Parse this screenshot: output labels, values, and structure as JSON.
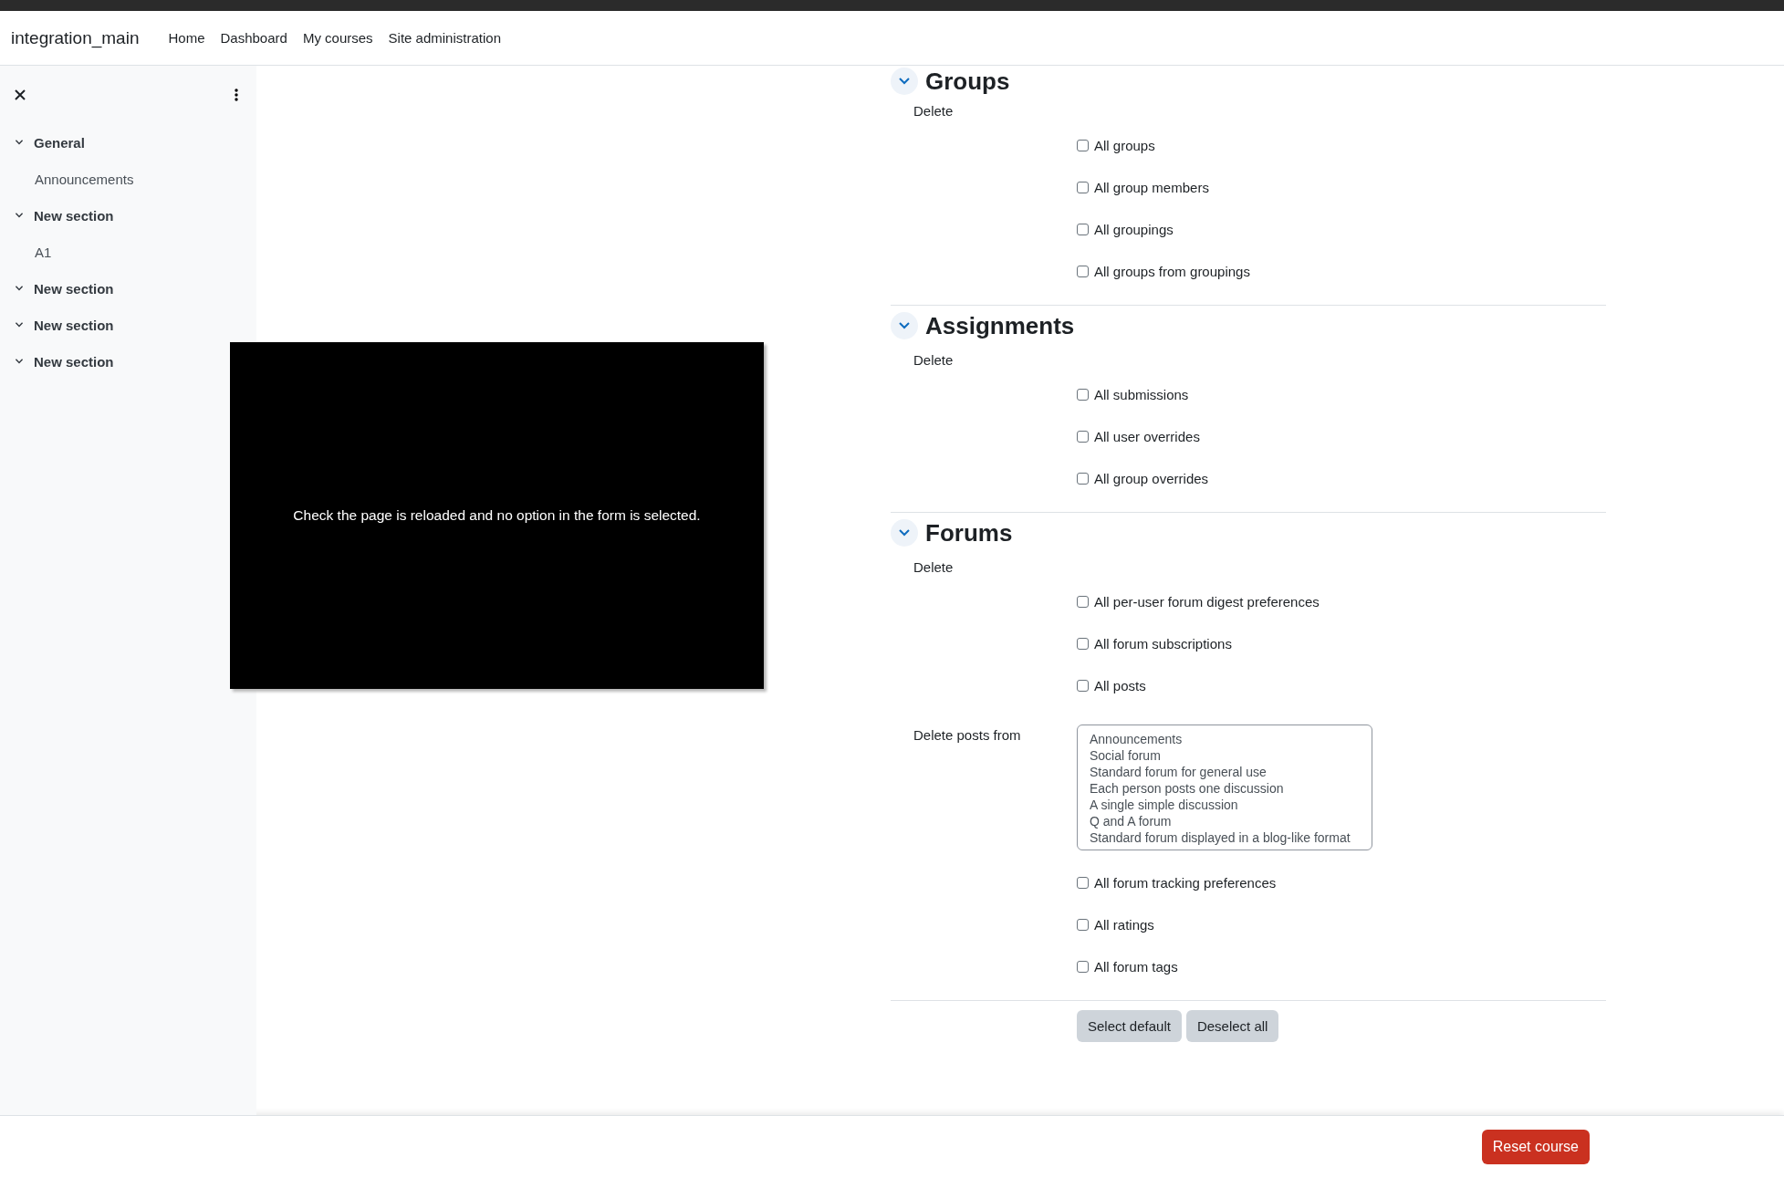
{
  "navbar": {
    "brand": "integration_main",
    "links": [
      "Home",
      "Dashboard",
      "My courses",
      "Site administration"
    ]
  },
  "drawer": {
    "sections": [
      {
        "label": "General",
        "expanded": true,
        "children": [
          {
            "label": "Announcements"
          }
        ]
      },
      {
        "label": "New section",
        "expanded": true,
        "children": [
          {
            "label": "A1"
          }
        ]
      },
      {
        "label": "New section",
        "expanded": true
      },
      {
        "label": "New section",
        "expanded": true
      },
      {
        "label": "New section",
        "expanded": true
      }
    ]
  },
  "sections": [
    {
      "title": "Groups",
      "expanded": true,
      "delete_label": "Delete",
      "fields": [
        {
          "kind": "checkbox",
          "label": "All groups",
          "checked": false
        },
        {
          "kind": "checkbox",
          "label": "All group members",
          "checked": false
        },
        {
          "kind": "checkbox",
          "label": "All groupings",
          "checked": false
        },
        {
          "kind": "checkbox",
          "label": "All groups from groupings",
          "checked": false
        }
      ]
    },
    {
      "title": "Assignments",
      "expanded": true,
      "delete_label": "Delete",
      "fields": [
        {
          "kind": "checkbox",
          "label": "All submissions",
          "checked": false
        },
        {
          "kind": "checkbox",
          "label": "All user overrides",
          "checked": false
        },
        {
          "kind": "checkbox",
          "label": "All group overrides",
          "checked": false
        }
      ]
    },
    {
      "title": "Forums",
      "expanded": true,
      "delete_label": "Delete",
      "fields": [
        {
          "kind": "checkbox",
          "label": "All per-user forum digest preferences",
          "checked": false
        },
        {
          "kind": "checkbox",
          "label": "All forum subscriptions",
          "checked": false
        },
        {
          "kind": "checkbox",
          "label": "All posts",
          "checked": false
        },
        {
          "kind": "listbox",
          "label": "Delete posts from",
          "options": [
            {
              "label": "Announcements",
              "selected": false
            },
            {
              "label": "Social forum",
              "selected": false
            },
            {
              "label": "Standard forum for general use",
              "selected": false
            },
            {
              "label": "Each person posts one discussion",
              "selected": false
            },
            {
              "label": "A single simple discussion",
              "selected": false
            },
            {
              "label": "Q and A forum",
              "selected": false
            },
            {
              "label": "Standard forum displayed in a blog-like format",
              "selected": false
            }
          ]
        },
        {
          "kind": "checkbox",
          "label": "All forum tracking preferences",
          "checked": false
        },
        {
          "kind": "checkbox",
          "label": "All ratings",
          "checked": false
        },
        {
          "kind": "checkbox",
          "label": "All forum tags",
          "checked": false
        }
      ]
    }
  ],
  "form_buttons": [
    "Select default",
    "Deselect all"
  ],
  "footer": {
    "button": "Reset course"
  },
  "caption": "Check the page is reloaded and no option in the form is selected."
}
